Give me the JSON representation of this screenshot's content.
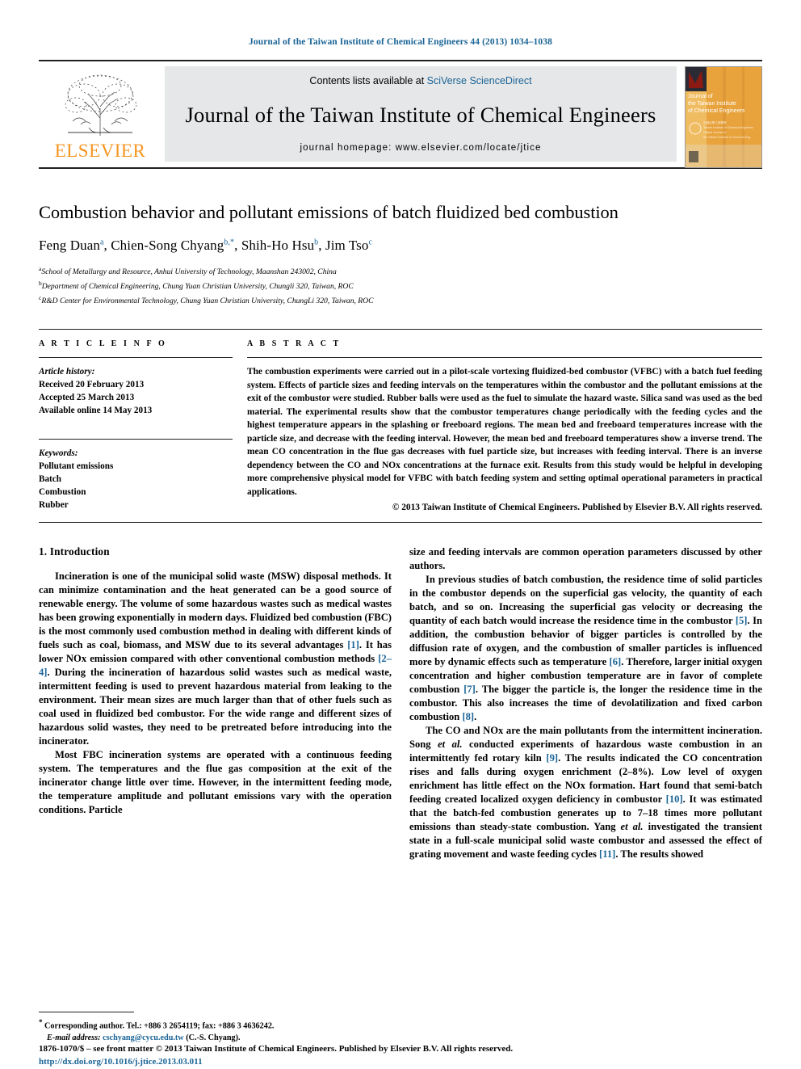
{
  "running_head": "Journal of the Taiwan Institute of Chemical Engineers 44 (2013) 1034–1038",
  "masthead": {
    "publisher_name": "ELSEVIER",
    "contents_prefix": "Contents lists available at ",
    "contents_link": "SciVerse ScienceDirect",
    "journal_name": "Journal of the Taiwan Institute of Chemical Engineers",
    "homepage": "journal homepage: www.elsevier.com/locate/jtice",
    "cover": {
      "line1": "Journal of",
      "line2": "the Taiwan Institute",
      "line3": "of Chemical Engineers",
      "bg_color": "#e8a33d"
    }
  },
  "article": {
    "title": "Combustion behavior and pollutant emissions of batch fluidized bed combustion",
    "authors": [
      {
        "name": "Feng Duan",
        "sup": "a",
        "sep": ", "
      },
      {
        "name": "Chien-Song Chyang",
        "sup": "b,*",
        "sep": ", "
      },
      {
        "name": "Shih-Ho Hsu",
        "sup": "b",
        "sep": ", "
      },
      {
        "name": "Jim Tso",
        "sup": "c",
        "sep": ""
      }
    ],
    "affiliations": [
      {
        "sup": "a",
        "text": "School of Metallurgy and Resource, Anhui University of Technology, Maanshan 243002, China"
      },
      {
        "sup": "b",
        "text": "Department of Chemical Engineering, Chung Yuan Christian University, Chungli 320, Taiwan, ROC"
      },
      {
        "sup": "c",
        "text": "R&D Center for Environmental Technology, Chung Yuan Christian University, ChungLi 320, Taiwan, ROC"
      }
    ]
  },
  "article_info": {
    "heading": "A R T I C L E  I N F O",
    "history_label": "Article history:",
    "history": [
      "Received 20 February 2013",
      "Accepted 25 March 2013",
      "Available online 14 May 2013"
    ],
    "keywords_label": "Keywords:",
    "keywords": [
      "Pollutant emissions",
      "Batch",
      "Combustion",
      "Rubber"
    ]
  },
  "abstract": {
    "heading": "A B S T R A C T",
    "text": "The combustion experiments were carried out in a pilot-scale vortexing fluidized-bed combustor (VFBC) with a batch fuel feeding system. Effects of particle sizes and feeding intervals on the temperatures within the combustor and the pollutant emissions at the exit of the combustor were studied. Rubber balls were used as the fuel to simulate the hazard waste. Silica sand was used as the bed material. The experimental results show that the combustor temperatures change periodically with the feeding cycles and the highest temperature appears in the splashing or freeboard regions. The mean bed and freeboard temperatures increase with the particle size, and decrease with the feeding interval. However, the mean bed and freeboard temperatures show a inverse trend. The mean CO concentration in the flue gas decreases with fuel particle size, but increases with feeding interval. There is an inverse dependency between the CO and NOx concentrations at the furnace exit. Results from this study would be helpful in developing more comprehensive physical model for VFBC with batch feeding system and setting optimal operational parameters in practical applications.",
    "copyright": "© 2013 Taiwan Institute of Chemical Engineers. Published by Elsevier B.V. All rights reserved."
  },
  "section": {
    "heading": "1. Introduction",
    "left_paragraphs": [
      "Incineration is one of the municipal solid waste (MSW) disposal methods. It can minimize contamination and the heat generated can be a good source of renewable energy. The volume of some hazardous wastes such as medical wastes has been growing exponentially in modern days. Fluidized bed combustion (FBC) is the most commonly used combustion method in dealing with different kinds of fuels such as coal, biomass, and MSW due to its several advantages [1]. It has lower NOx emission compared with other conventional combustion methods [2–4]. During the incineration of hazardous solid wastes such as medical waste, intermittent feeding is used to prevent hazardous material from leaking to the environment. Their mean sizes are much larger than that of other fuels such as coal used in fluidized bed combustor. For the wide range and different sizes of hazardous solid wastes, they need to be pretreated before introducing into the incinerator.",
      "Most FBC incineration systems are operated with a continuous feeding system. The temperatures and the flue gas composition at the exit of the incinerator change little over time. However, in the intermittent feeding mode, the temperature amplitude and pollutant emissions vary with the operation conditions. Particle"
    ],
    "right_paragraphs": [
      "size and feeding intervals are common operation parameters discussed by other authors.",
      "In previous studies of batch combustion, the residence time of solid particles in the combustor depends on the superficial gas velocity, the quantity of each batch, and so on. Increasing the superficial gas velocity or decreasing the quantity of each batch would increase the residence time in the combustor [5]. In addition, the combustion behavior of bigger particles is controlled by the diffusion rate of oxygen, and the combustion of smaller particles is influenced more by dynamic effects such as temperature [6]. Therefore, larger initial oxygen concentration and higher combustion temperature are in favor of complete combustion [7]. The bigger the particle is, the longer the residence time in the combustor. This also increases the time of devolatilization and fixed carbon combustion [8].",
      "The CO and NOx are the main pollutants from the intermittent incineration. Song et al. conducted experiments of hazardous waste combustion in an intermittently fed rotary kiln [9]. The results indicated the CO concentration rises and falls during oxygen enrichment (2–8%). Low level of oxygen enrichment has little effect on the NOx formation. Hart found that semi-batch feeding created localized oxygen deficiency in combustor [10]. It was estimated that the batch-fed combustion generates up to 7–18 times more pollutant emissions than steady-state combustion. Yang et al. investigated the transient state in a full-scale municipal solid waste combustor and assessed the effect of grating movement and waste feeding cycles [11]. The results showed"
    ]
  },
  "footnote": {
    "marker": "*",
    "corresponding": "Corresponding author. Tel.: +886 3 2654119; fax: +886 3 4636242.",
    "email_label": "E-mail address:",
    "email": "cschyang@cycu.edu.tw",
    "email_suffix": "(C.-S. Chyang)."
  },
  "footer": {
    "issn_line": "1876-1070/$ – see front matter © 2013 Taiwan Institute of Chemical Engineers. Published by Elsevier B.V. All rights reserved.",
    "doi": "http://dx.doi.org/10.1016/j.jtice.2013.03.011"
  },
  "colors": {
    "link": "#1a6496",
    "elsevier_orange": "#f4951f",
    "masthead_gray": "#e6e7e8"
  }
}
